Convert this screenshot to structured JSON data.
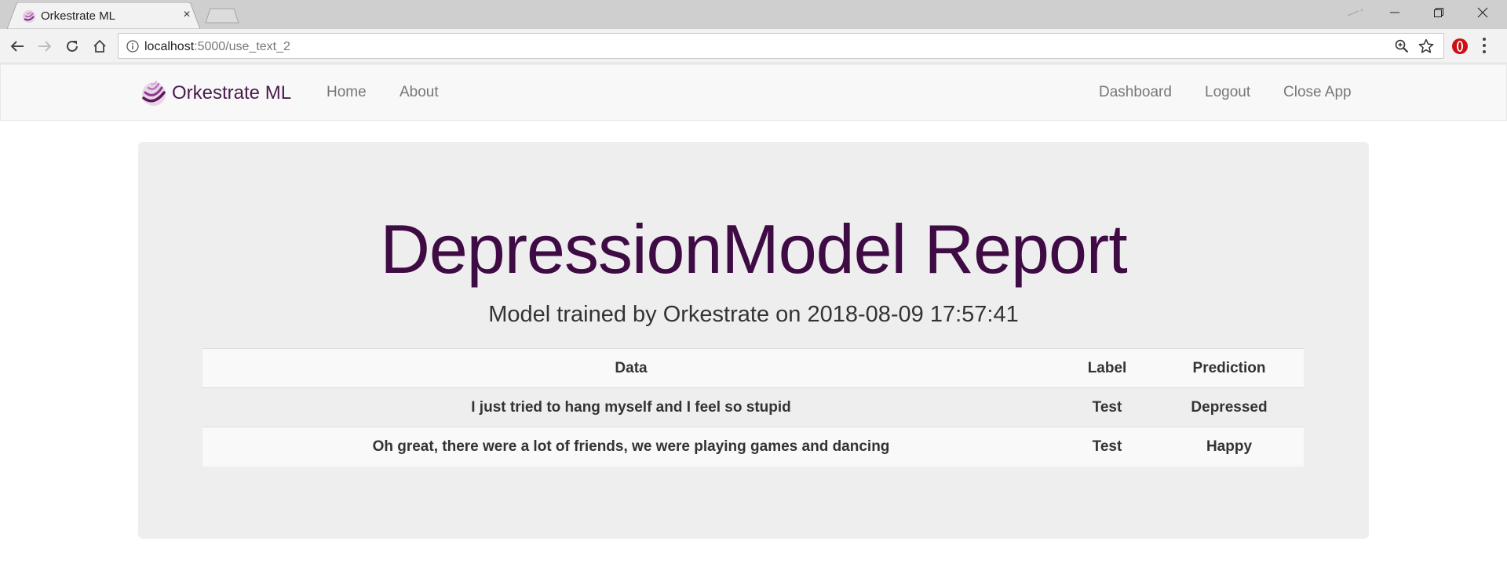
{
  "browser": {
    "tab_title": "Orkestrate ML",
    "tab_close": "×",
    "url_host": "localhost",
    "url_path": ":5000/use_text_2"
  },
  "navbar": {
    "brand": "Orkestrate ML",
    "left_links": [
      "Home",
      "About"
    ],
    "right_links": [
      "Dashboard",
      "Logout",
      "Close App"
    ]
  },
  "report": {
    "title": "DepressionModel Report",
    "subtitle": "Model trained by Orkestrate on 2018-08-09 17:57:41",
    "columns": [
      "Data",
      "Label",
      "Prediction"
    ],
    "rows": [
      {
        "data": "I just tried to hang myself and I feel so stupid",
        "label": "Test",
        "prediction": "Depressed"
      },
      {
        "data": "Oh great, there were a lot of friends, we were playing games and dancing",
        "label": "Test",
        "prediction": "Happy"
      }
    ]
  },
  "colors": {
    "brand": "#4a1a4c",
    "title": "#3f0b44",
    "jumbotron": "#eeeeee",
    "navbar_bg": "#f8f8f8",
    "link": "#777777"
  },
  "icons": {
    "favicon": "orkestrate-logo-icon",
    "back": "back-arrow-icon",
    "forward": "forward-arrow-icon",
    "reload": "reload-icon",
    "home": "home-icon",
    "info": "info-icon",
    "zoom": "zoom-icon",
    "bookmark": "star-icon",
    "extension": "opera-icon",
    "menu": "kebab-menu-icon"
  }
}
